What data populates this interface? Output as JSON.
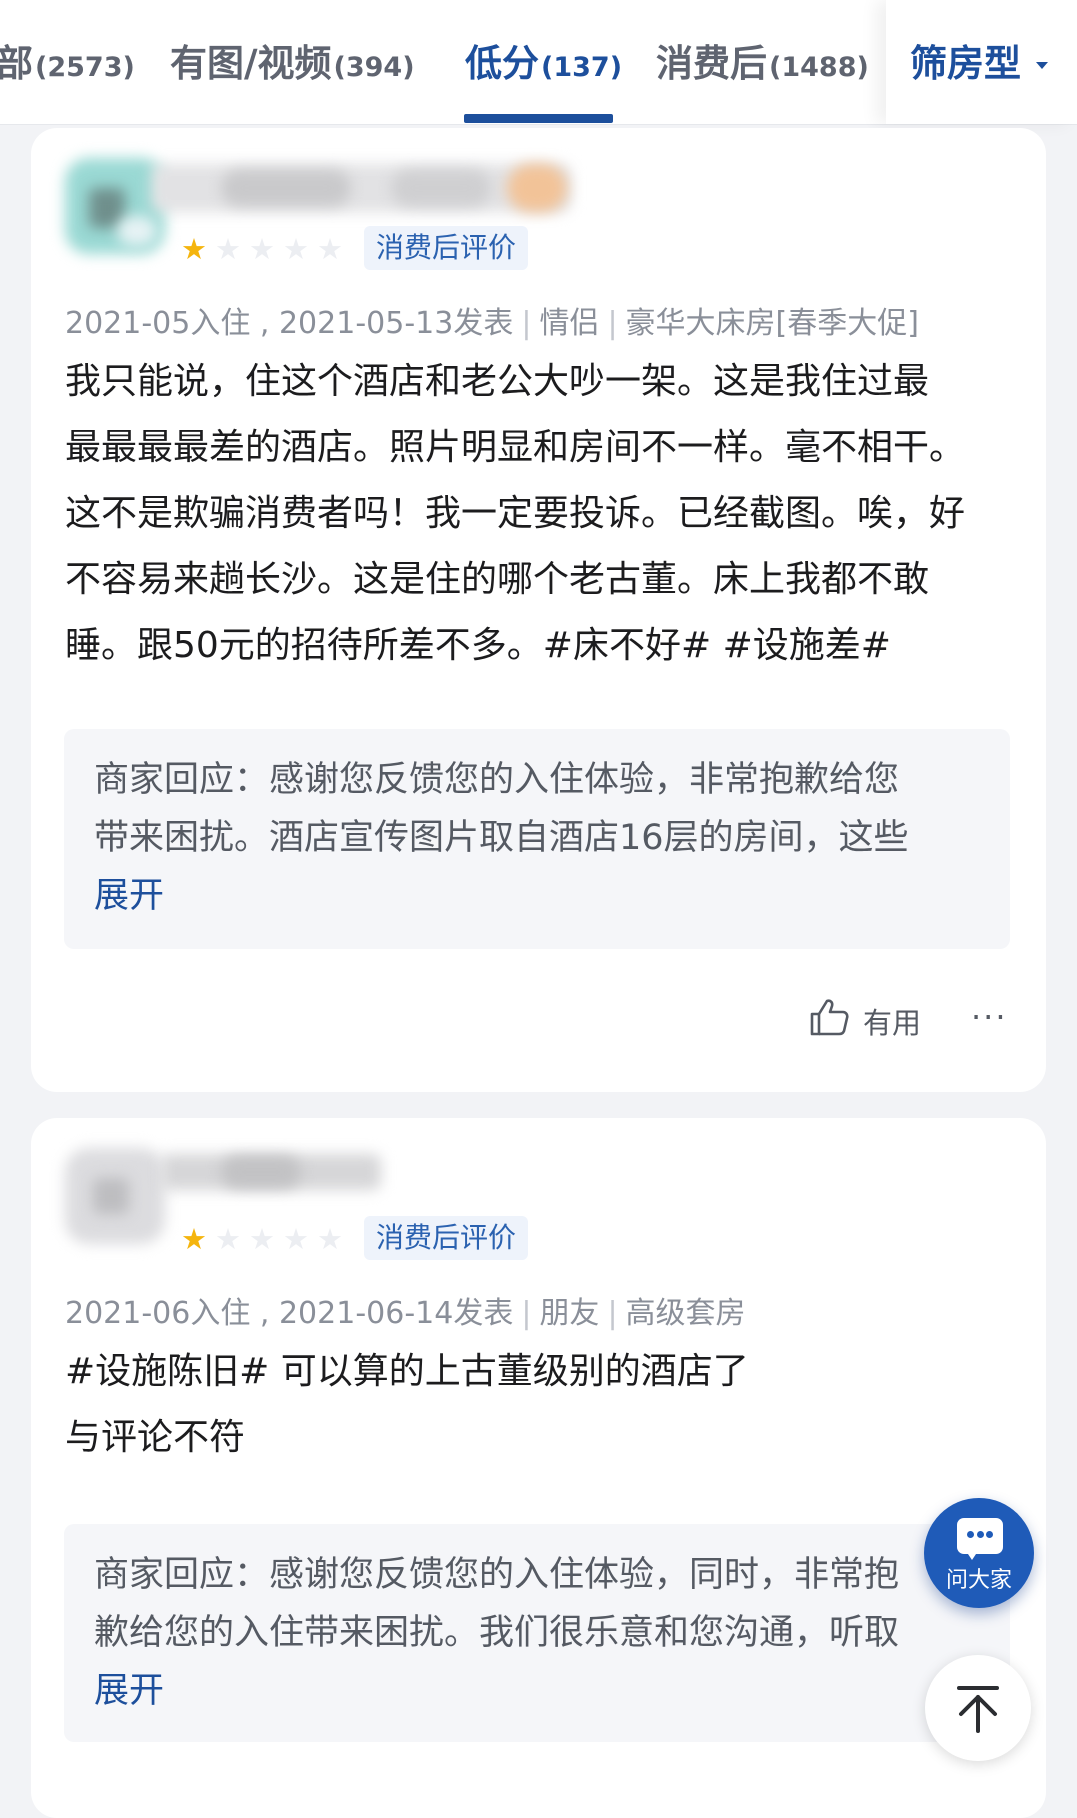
{
  "tabs": [
    {
      "label": "部",
      "count": "(2573)",
      "active": false
    },
    {
      "label": "有图/视频",
      "count": "(394)",
      "active": false
    },
    {
      "label": "低分",
      "count": "(137)",
      "active": true
    },
    {
      "label": "消费后",
      "count": "(1488)",
      "active": false
    }
  ],
  "filter": {
    "label": "筛房型"
  },
  "reviews": [
    {
      "rating": 1,
      "rating_max": 5,
      "badge": "消费后评价",
      "checkin": "2021-05入住",
      "published": "2021-05-13发表",
      "traveler_type": "情侣",
      "room_type": "豪华大床房[春季大促]",
      "lines": [
        "我只能说，住这个酒店和老公大吵一架。这是我住过最",
        "最最最最差的酒店。照片明显和房间不一样。毫不相干。",
        "这不是欺骗消费者吗！我一定要投诉。已经截图。唉，好",
        "不容易来趟长沙。这是住的哪个老古董。床上我都不敢",
        "睡。跟50元的招待所差不多。#床不好# #设施差#"
      ],
      "reply_lines": [
        "商家回应：感谢您反馈您的入住体验，非常抱歉给您",
        "带来困扰。酒店宣传图片取自酒店16层的房间，这些"
      ],
      "expand_label": "展开",
      "useful_label": "有用",
      "more_label": "···"
    },
    {
      "rating": 1,
      "rating_max": 5,
      "badge": "消费后评价",
      "checkin": "2021-06入住",
      "published": "2021-06-14发表",
      "traveler_type": "朋友",
      "room_type": "高级套房",
      "lines": [
        "#设施陈旧# 可以算的上古董级别的酒店了",
        "与评论不符"
      ],
      "reply_lines": [
        "商家回应：感谢您反馈您的入住体验，同时，非常抱",
        "歉给您的入住带来困扰。我们很乐意和您沟通，听取"
      ],
      "expand_label": "展开"
    }
  ],
  "floating": {
    "ask_label": "问大家"
  },
  "colors": {
    "accent": "#1d4f9c",
    "star": "#f5b50e",
    "badge_bg": "#eef3fb"
  }
}
